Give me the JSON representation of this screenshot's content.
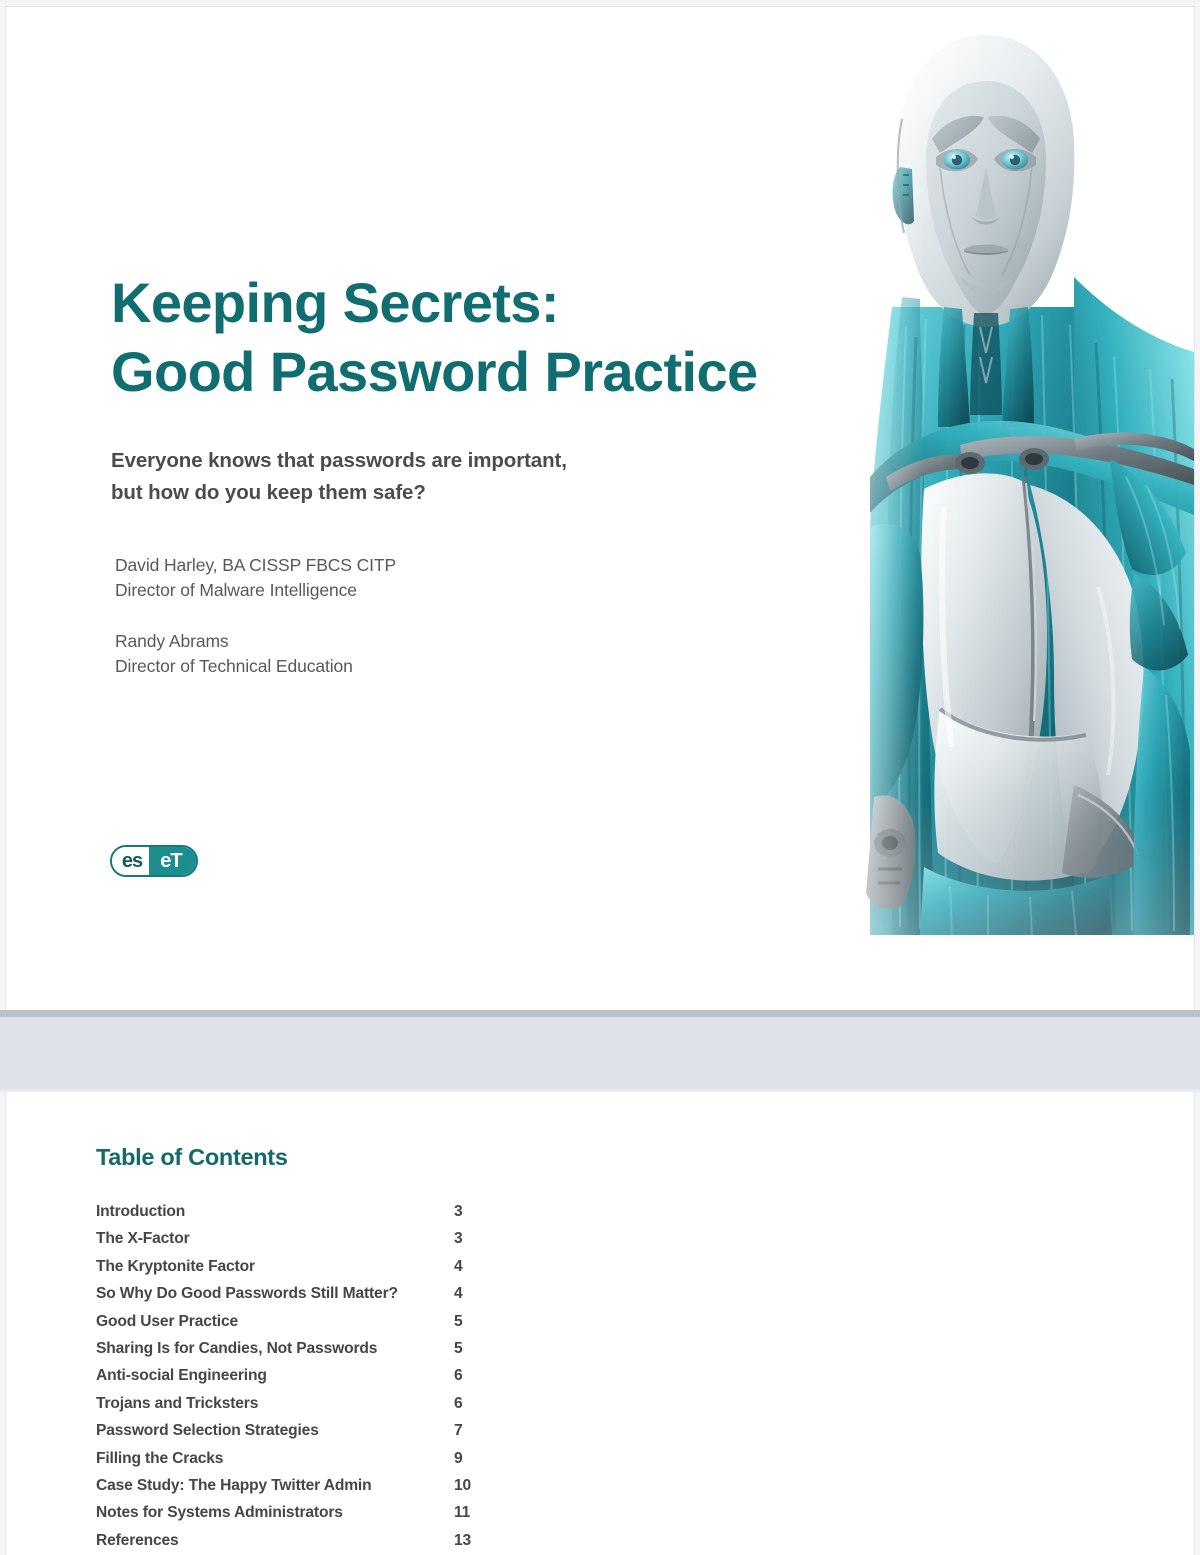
{
  "document": {
    "title": "Keeping Secrets:\nGood Password Practice",
    "subtitle": "Everyone knows that passwords are important,\nbut how do you keep them safe?"
  },
  "authors": [
    {
      "name": "David Harley, BA CISSP FBCS CITP",
      "role": "Director of Malware Intelligence"
    },
    {
      "name": "Randy Abrams",
      "role": "Director of Technical Education"
    }
  ],
  "brand": {
    "logo_part1": "es",
    "logo_part2": "eT",
    "teal": "#106e70",
    "logo_fill": "#1c8e8e",
    "logo_border": "#15797b"
  },
  "artwork": {
    "name": "eset-android-mascot",
    "description": "Silver humanoid android with teal fibre musculature",
    "metal_light": "#eef1f2",
    "metal_mid": "#c3cbcf",
    "metal_dark": "#8e999e",
    "teal_light": "#6fd3da",
    "teal_mid": "#2a9fad",
    "teal_dark": "#12606e",
    "eye_color": "#7fd5e2"
  },
  "toc": {
    "heading": "Table of Contents",
    "entries": [
      {
        "label": "Introduction",
        "page": "3"
      },
      {
        "label": "The X-Factor",
        "page": "3"
      },
      {
        "label": "The Kryptonite Factor",
        "page": "4"
      },
      {
        "label": "So Why Do Good Passwords Still Matter?",
        "page": "4"
      },
      {
        "label": "Good User Practice",
        "page": "5"
      },
      {
        "label": "Sharing Is for Candies, Not Passwords",
        "page": "5"
      },
      {
        "label": "Anti-social Engineering",
        "page": "6"
      },
      {
        "label": "Trojans and Tricksters",
        "page": "6"
      },
      {
        "label": "Password Selection Strategies",
        "page": "7"
      },
      {
        "label": "Filling the Cracks",
        "page": "9"
      },
      {
        "label": "Case Study: The Happy Twitter Admin",
        "page": "10"
      },
      {
        "label": "Notes for Systems Administrators",
        "page": "11"
      },
      {
        "label": "References",
        "page": "13"
      }
    ]
  }
}
